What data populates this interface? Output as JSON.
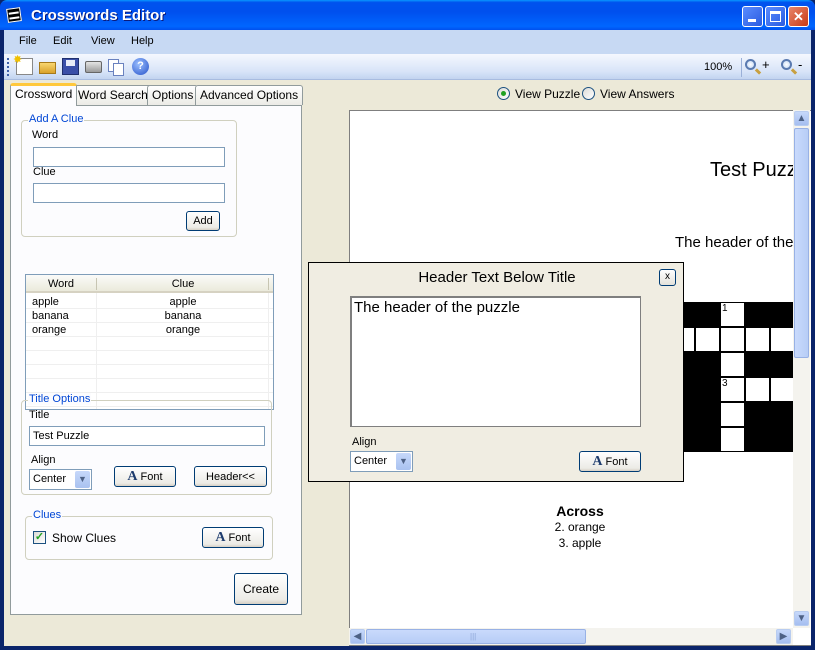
{
  "window": {
    "title": "Crosswords Editor",
    "controls": {
      "minimize": "minimize",
      "maximize": "maximize",
      "close": "✕"
    }
  },
  "menu": [
    "File",
    "Edit",
    "View",
    "Help"
  ],
  "toolbar": {
    "icons": [
      "new-icon",
      "open-icon",
      "save-icon",
      "print-icon",
      "copy-icon",
      "help-icon"
    ],
    "help_glyph": "?",
    "zoom_level": "100%",
    "zoom_in_label": "+",
    "zoom_out_label": "-"
  },
  "tabs": [
    {
      "label": "Crossword",
      "active": true
    },
    {
      "label": "Word Search",
      "active": false
    },
    {
      "label": "Options",
      "active": false
    },
    {
      "label": "Advanced Options",
      "active": false
    }
  ],
  "add_clue": {
    "legend": "Add A Clue",
    "word_label": "Word",
    "word_value": "",
    "clue_label": "Clue",
    "clue_value": "",
    "add_button": "Add"
  },
  "word_list": {
    "columns": [
      "Word",
      "Clue"
    ],
    "rows": [
      {
        "word": "apple",
        "clue": "apple"
      },
      {
        "word": "banana",
        "clue": "banana"
      },
      {
        "word": "orange",
        "clue": "orange"
      }
    ]
  },
  "title_options": {
    "legend": "Title Options",
    "title_label": "Title",
    "title_value": "Test Puzzle",
    "align_label": "Align",
    "align_value": "Center",
    "font_button": "Font",
    "header_button": "Header<<"
  },
  "clues_options": {
    "legend": "Clues",
    "show_clues_label": "Show Clues",
    "show_clues_checked": true,
    "check_glyph": "✓",
    "font_button": "Font"
  },
  "create_button": "Create",
  "view_mode": {
    "options": [
      {
        "label": "View Puzzle",
        "checked": true
      },
      {
        "label": "View Answers",
        "checked": false
      }
    ]
  },
  "preview": {
    "title": "Test Puzz",
    "header": "The header of the",
    "clues_heading": "Across",
    "clues": [
      "2. orange",
      "3. apple"
    ],
    "grid_numbers": {
      "1": "1",
      "3": "3"
    }
  },
  "scrollbars": {
    "up": "▲",
    "down": "▼",
    "left": "◀",
    "right": "▶",
    "grip": "|||"
  },
  "header_dialog": {
    "title": "Header Text Below Title",
    "close_label": "x",
    "text_value": "The header of the puzzle",
    "align_label": "Align",
    "align_value": "Center",
    "font_button": "Font"
  },
  "font_glyph": "A",
  "combo_arrow": "▼"
}
